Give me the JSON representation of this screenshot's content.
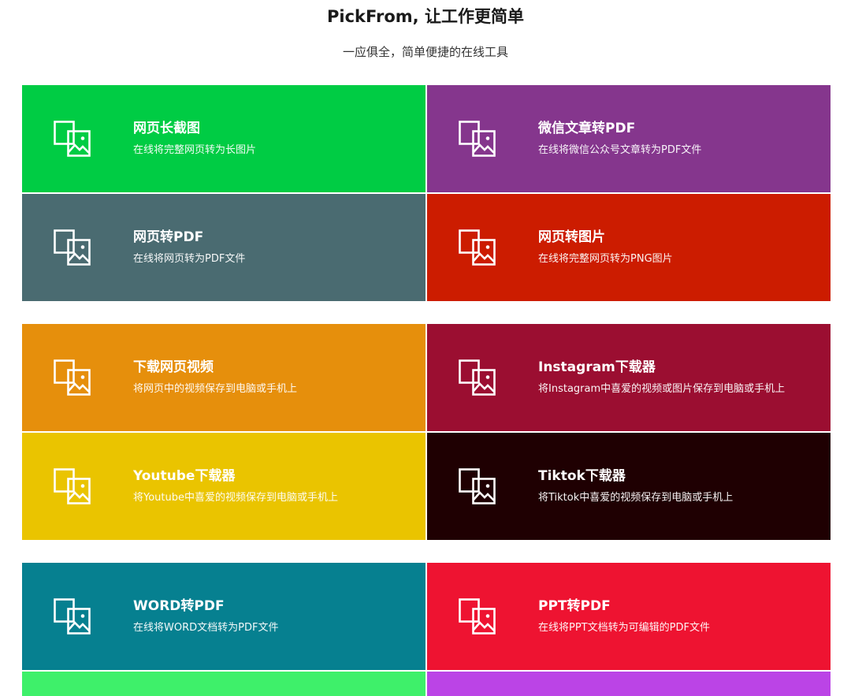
{
  "header": {
    "title": "PickFrom, 让工作更简单",
    "subtitle": "一应俱全，简单便捷的在线工具"
  },
  "icon": "image-files-icon",
  "sections": [
    {
      "cards": [
        {
          "title": "网页长截图",
          "desc": "在线将完整网页转为长图片",
          "color": "#00cc44"
        },
        {
          "title": "微信文章转PDF",
          "desc": "在线将微信公众号文章转为PDF文件",
          "color": "#85368d"
        },
        {
          "title": "网页转PDF",
          "desc": "在线将网页转为PDF文件",
          "color": "#4a6b71"
        },
        {
          "title": "网页转图片",
          "desc": "在线将完整网页转为PNG图片",
          "color": "#cc1c00"
        }
      ]
    },
    {
      "cards": [
        {
          "title": "下载网页视频",
          "desc": "将网页中的视频保存到电脑或手机上",
          "color": "#e68f0c"
        },
        {
          "title": "Instagram下载器",
          "desc": "将Instagram中喜爱的视频或图片保存到电脑或手机上",
          "color": "#9b0e31"
        },
        {
          "title": "Youtube下载器",
          "desc": "将Youtube中喜爱的视频保存到电脑或手机上",
          "color": "#eac400"
        },
        {
          "title": "Tiktok下载器",
          "desc": "将Tiktok中喜爱的视频保存到电脑或手机上",
          "color": "#1f0002"
        }
      ]
    },
    {
      "cards": [
        {
          "title": "WORD转PDF",
          "desc": "在线将WORD文档转为PDF文件",
          "color": "#068090"
        },
        {
          "title": "PPT转PDF",
          "desc": "在线将PPT文档转为可编辑的PDF文件",
          "color": "#ee1331"
        }
      ]
    }
  ],
  "partial_cards": [
    {
      "color": "#3ef06a"
    },
    {
      "color": "#bb44e6"
    }
  ]
}
